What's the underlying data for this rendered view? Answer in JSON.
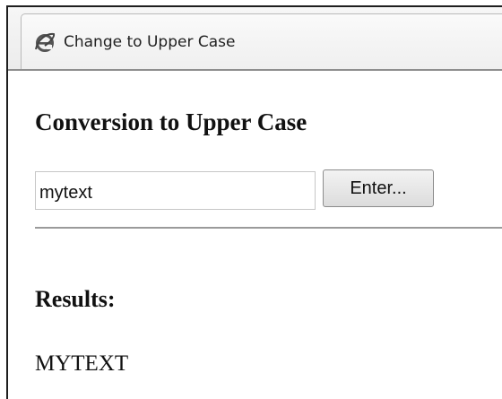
{
  "tab": {
    "icon": "internet-explorer-icon",
    "title": "Change to Upper Case"
  },
  "page": {
    "heading": "Conversion to Upper Case",
    "input": {
      "value": "mytext"
    },
    "enter_button_label": "Enter...",
    "results_heading": "Results:",
    "result_value": "MYTEXT"
  }
}
